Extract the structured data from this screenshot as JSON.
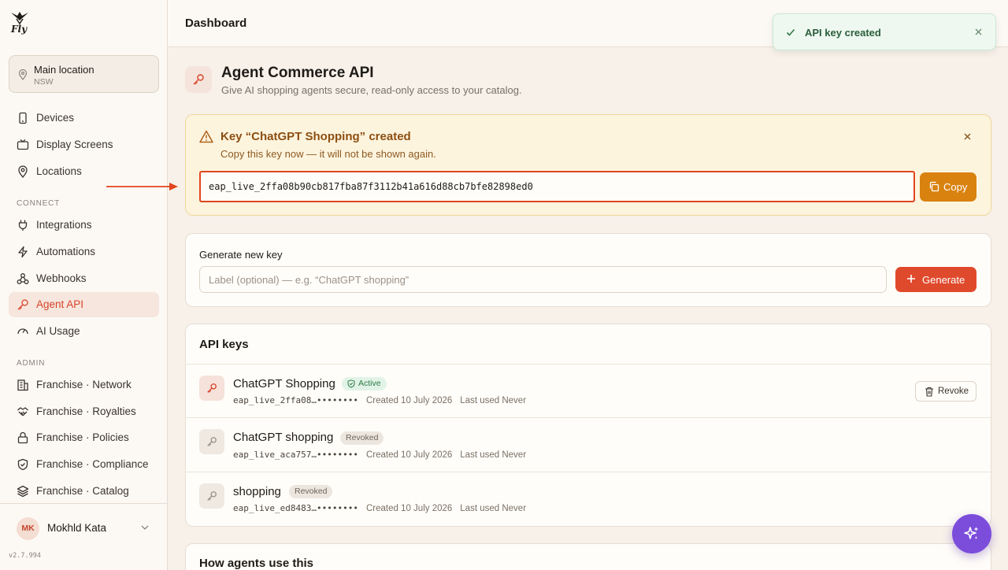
{
  "app": {
    "logo_text": "Fly",
    "version": "v2.7.994"
  },
  "location": {
    "name": "Main location",
    "region": "NSW"
  },
  "nav": {
    "main": [
      {
        "label": "Devices",
        "icon": "device-icon"
      },
      {
        "label": "Display Screens",
        "icon": "display-icon"
      },
      {
        "label": "Locations",
        "icon": "location-pin-icon"
      }
    ],
    "connect_label": "CONNECT",
    "connect": [
      {
        "label": "Integrations",
        "icon": "plug-icon"
      },
      {
        "label": "Automations",
        "icon": "lightning-icon"
      },
      {
        "label": "Webhooks",
        "icon": "webhook-icon"
      },
      {
        "label": "Agent API",
        "icon": "key-icon",
        "active": true
      },
      {
        "label": "AI Usage",
        "icon": "gauge-icon"
      }
    ],
    "admin_label": "ADMIN",
    "admin": [
      {
        "label": "Franchise · Network",
        "icon": "building-icon"
      },
      {
        "label": "Franchise · Royalties",
        "icon": "handshake-icon"
      },
      {
        "label": "Franchise · Policies",
        "icon": "lock-icon"
      },
      {
        "label": "Franchise · Compliance",
        "icon": "shield-check-icon"
      },
      {
        "label": "Franchise · Catalog",
        "icon": "layers-icon"
      }
    ]
  },
  "user": {
    "initials": "MK",
    "name": "Mokhld Kata"
  },
  "topbar": {
    "title": "Dashboard"
  },
  "toast": {
    "message": "API key created"
  },
  "page": {
    "title": "Agent Commerce API",
    "subtitle": "Give AI shopping agents secure, read-only access to your catalog."
  },
  "created_key": {
    "title": "Key “ChatGPT Shopping” created",
    "subtitle": "Copy this key now — it will not be shown again.",
    "value": "eap_live_2ffa08b90cb817fba87f3112b41a616d88cb7bfe82898ed0",
    "copy_label": "Copy"
  },
  "generate": {
    "label": "Generate new key",
    "placeholder": "Label (optional) — e.g. “ChatGPT shopping”",
    "button_label": "Generate"
  },
  "api_keys": {
    "title": "API keys",
    "revoke_label": "Revoke",
    "items": [
      {
        "name": "ChatGPT Shopping",
        "status": "Active",
        "prefix": "eap_live_2ffa08…••••••••",
        "created": "Created 10 July 2026",
        "last_used": "Last used Never"
      },
      {
        "name": "ChatGPT shopping",
        "status": "Revoked",
        "prefix": "eap_live_aca757…••••••••",
        "created": "Created 10 July 2026",
        "last_used": "Last used Never"
      },
      {
        "name": "shopping",
        "status": "Revoked",
        "prefix": "eap_live_ed8483…••••••••",
        "created": "Created 10 July 2026",
        "last_used": "Last used Never"
      }
    ]
  },
  "how": {
    "title": "How agents use this"
  },
  "colors": {
    "accent": "#e04a2c",
    "copy_button": "#d9820f",
    "warning_bg": "#fdf4de",
    "success": "#2e7a47",
    "fab": "#7c4ddb"
  }
}
